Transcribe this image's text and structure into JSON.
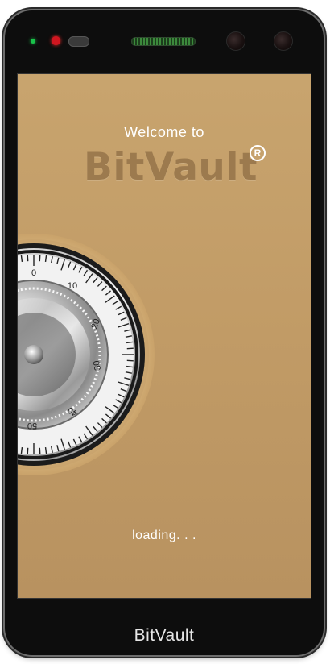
{
  "screen": {
    "welcome_text": "Welcome to",
    "brand_name": "BitVault",
    "registered_mark": "R",
    "loading_text": "loading. . .",
    "background_color": "#c4a06a",
    "brand_color": "#9c7a4e"
  },
  "dial": {
    "numbers": [
      "0",
      "10",
      "20",
      "30",
      "40",
      "50"
    ]
  },
  "device": {
    "bottom_label": "BitVault"
  }
}
